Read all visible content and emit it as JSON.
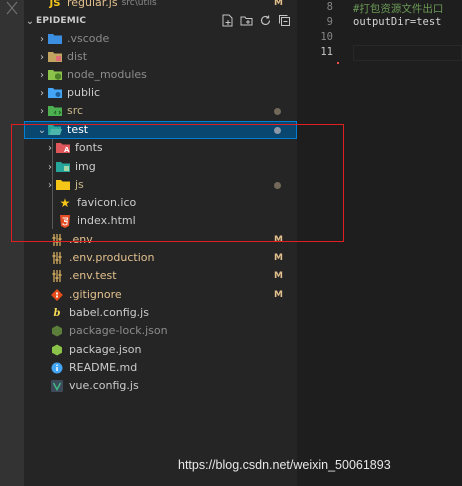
{
  "top_partial": {
    "label": "regular.js",
    "desc": "src\\utils",
    "status": "M"
  },
  "explorer": {
    "section_title": "EPIDEMIC",
    "tree": [
      {
        "label": "vscode",
        "prefix": ".",
        "kind": "folder",
        "status": "",
        "dimmed": true
      },
      {
        "label": "dist",
        "kind": "folder",
        "status": "",
        "dimmed": true
      },
      {
        "label": "node_modules",
        "kind": "folder",
        "status": "",
        "dimmed": true
      },
      {
        "label": "public",
        "kind": "folder",
        "status": ""
      },
      {
        "label": "src",
        "kind": "folder",
        "status": "dot"
      },
      {
        "label": "test",
        "kind": "folder-open",
        "status": "dot"
      },
      {
        "label": "fonts",
        "kind": "folder",
        "status": ""
      },
      {
        "label": "img",
        "kind": "folder",
        "status": ""
      },
      {
        "label": "js",
        "kind": "folder",
        "status": "dot"
      },
      {
        "label": "favicon.ico",
        "kind": "file",
        "status": ""
      },
      {
        "label": "index.html",
        "kind": "file",
        "status": ""
      },
      {
        "label": ".env",
        "kind": "file",
        "status": "M"
      },
      {
        "label": ".env.production",
        "kind": "file",
        "status": "M"
      },
      {
        "label": ".env.test",
        "kind": "file",
        "status": "M"
      },
      {
        "label": ".gitignore",
        "kind": "file",
        "status": "M"
      },
      {
        "label": "babel.config.js",
        "kind": "file",
        "status": ""
      },
      {
        "label": "package-lock.json",
        "kind": "file",
        "status": "",
        "dimmed": true
      },
      {
        "label": "package.json",
        "kind": "file",
        "status": ""
      },
      {
        "label": "README.md",
        "kind": "file",
        "status": ""
      },
      {
        "label": "vue.config.js",
        "kind": "file",
        "status": ""
      }
    ]
  },
  "icons": {
    "header": [
      "new-file-icon",
      "new-folder-icon",
      "refresh-icon",
      "collapse-all-icon"
    ],
    "colors": {
      "folder": "#dcb67a",
      "vscode": "#3c8fe0",
      "dist": "#e06c75",
      "node_modules": "#8bc34a",
      "public": "#42a5f5",
      "src": "#4caf50",
      "test": "#26a69a",
      "js": "#f5c518",
      "favicon": "#f5c518",
      "html": "#e44d26",
      "env": "#c5a05a",
      "gitignore": "#e64a19",
      "babel": "#f5da55",
      "json": "#8bc34a",
      "readme": "#42a5f5",
      "vue": "#41b883"
    }
  },
  "editor": {
    "lines": [
      {
        "num": "8",
        "text": "#打包资源文件出口"
      },
      {
        "num": "9",
        "text": "outputDir=test"
      },
      {
        "num": "10",
        "text": ""
      },
      {
        "num": "11",
        "text": "",
        "active": true
      }
    ]
  },
  "watermark": "https://blog.csdn.net/weixin_50061893"
}
